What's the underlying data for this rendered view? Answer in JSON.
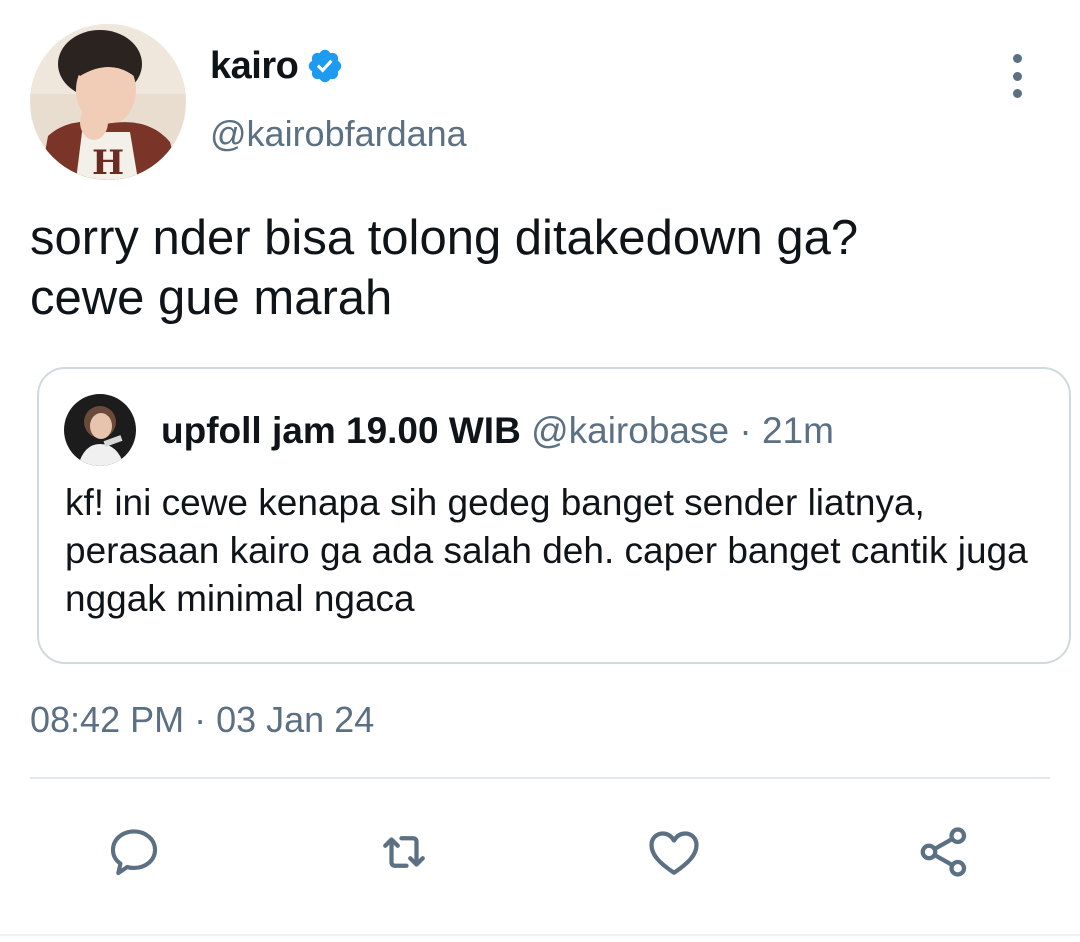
{
  "author": {
    "name": "kairo",
    "handle": "@kairobfardana",
    "verified": true
  },
  "tweet": {
    "text": "sorry nder bisa tolong ditakedown ga?\ncewe gue marah",
    "timestamp": "08:42 PM · 03 Jan 24"
  },
  "quoted": {
    "name": "upfoll jam 19.00 WIB",
    "handle": "@kairobase",
    "separator": "·",
    "time": "21m",
    "text": "kf! ini cewe kenapa sih gedeg banget sender liatnya, perasaan kairo ga ada salah deh. caper banget cantik juga nggak minimal ngaca"
  },
  "icons": {
    "more": "more-vertical-icon",
    "verified": "verified-badge-icon",
    "reply": "reply-icon",
    "retweet": "retweet-icon",
    "like": "heart-icon",
    "share": "share-icon"
  },
  "colors": {
    "text": "#0f1419",
    "secondary": "#5b7083",
    "verified": "#1d9bf0",
    "border": "#cfd9de",
    "divider": "#e1e8ed"
  }
}
